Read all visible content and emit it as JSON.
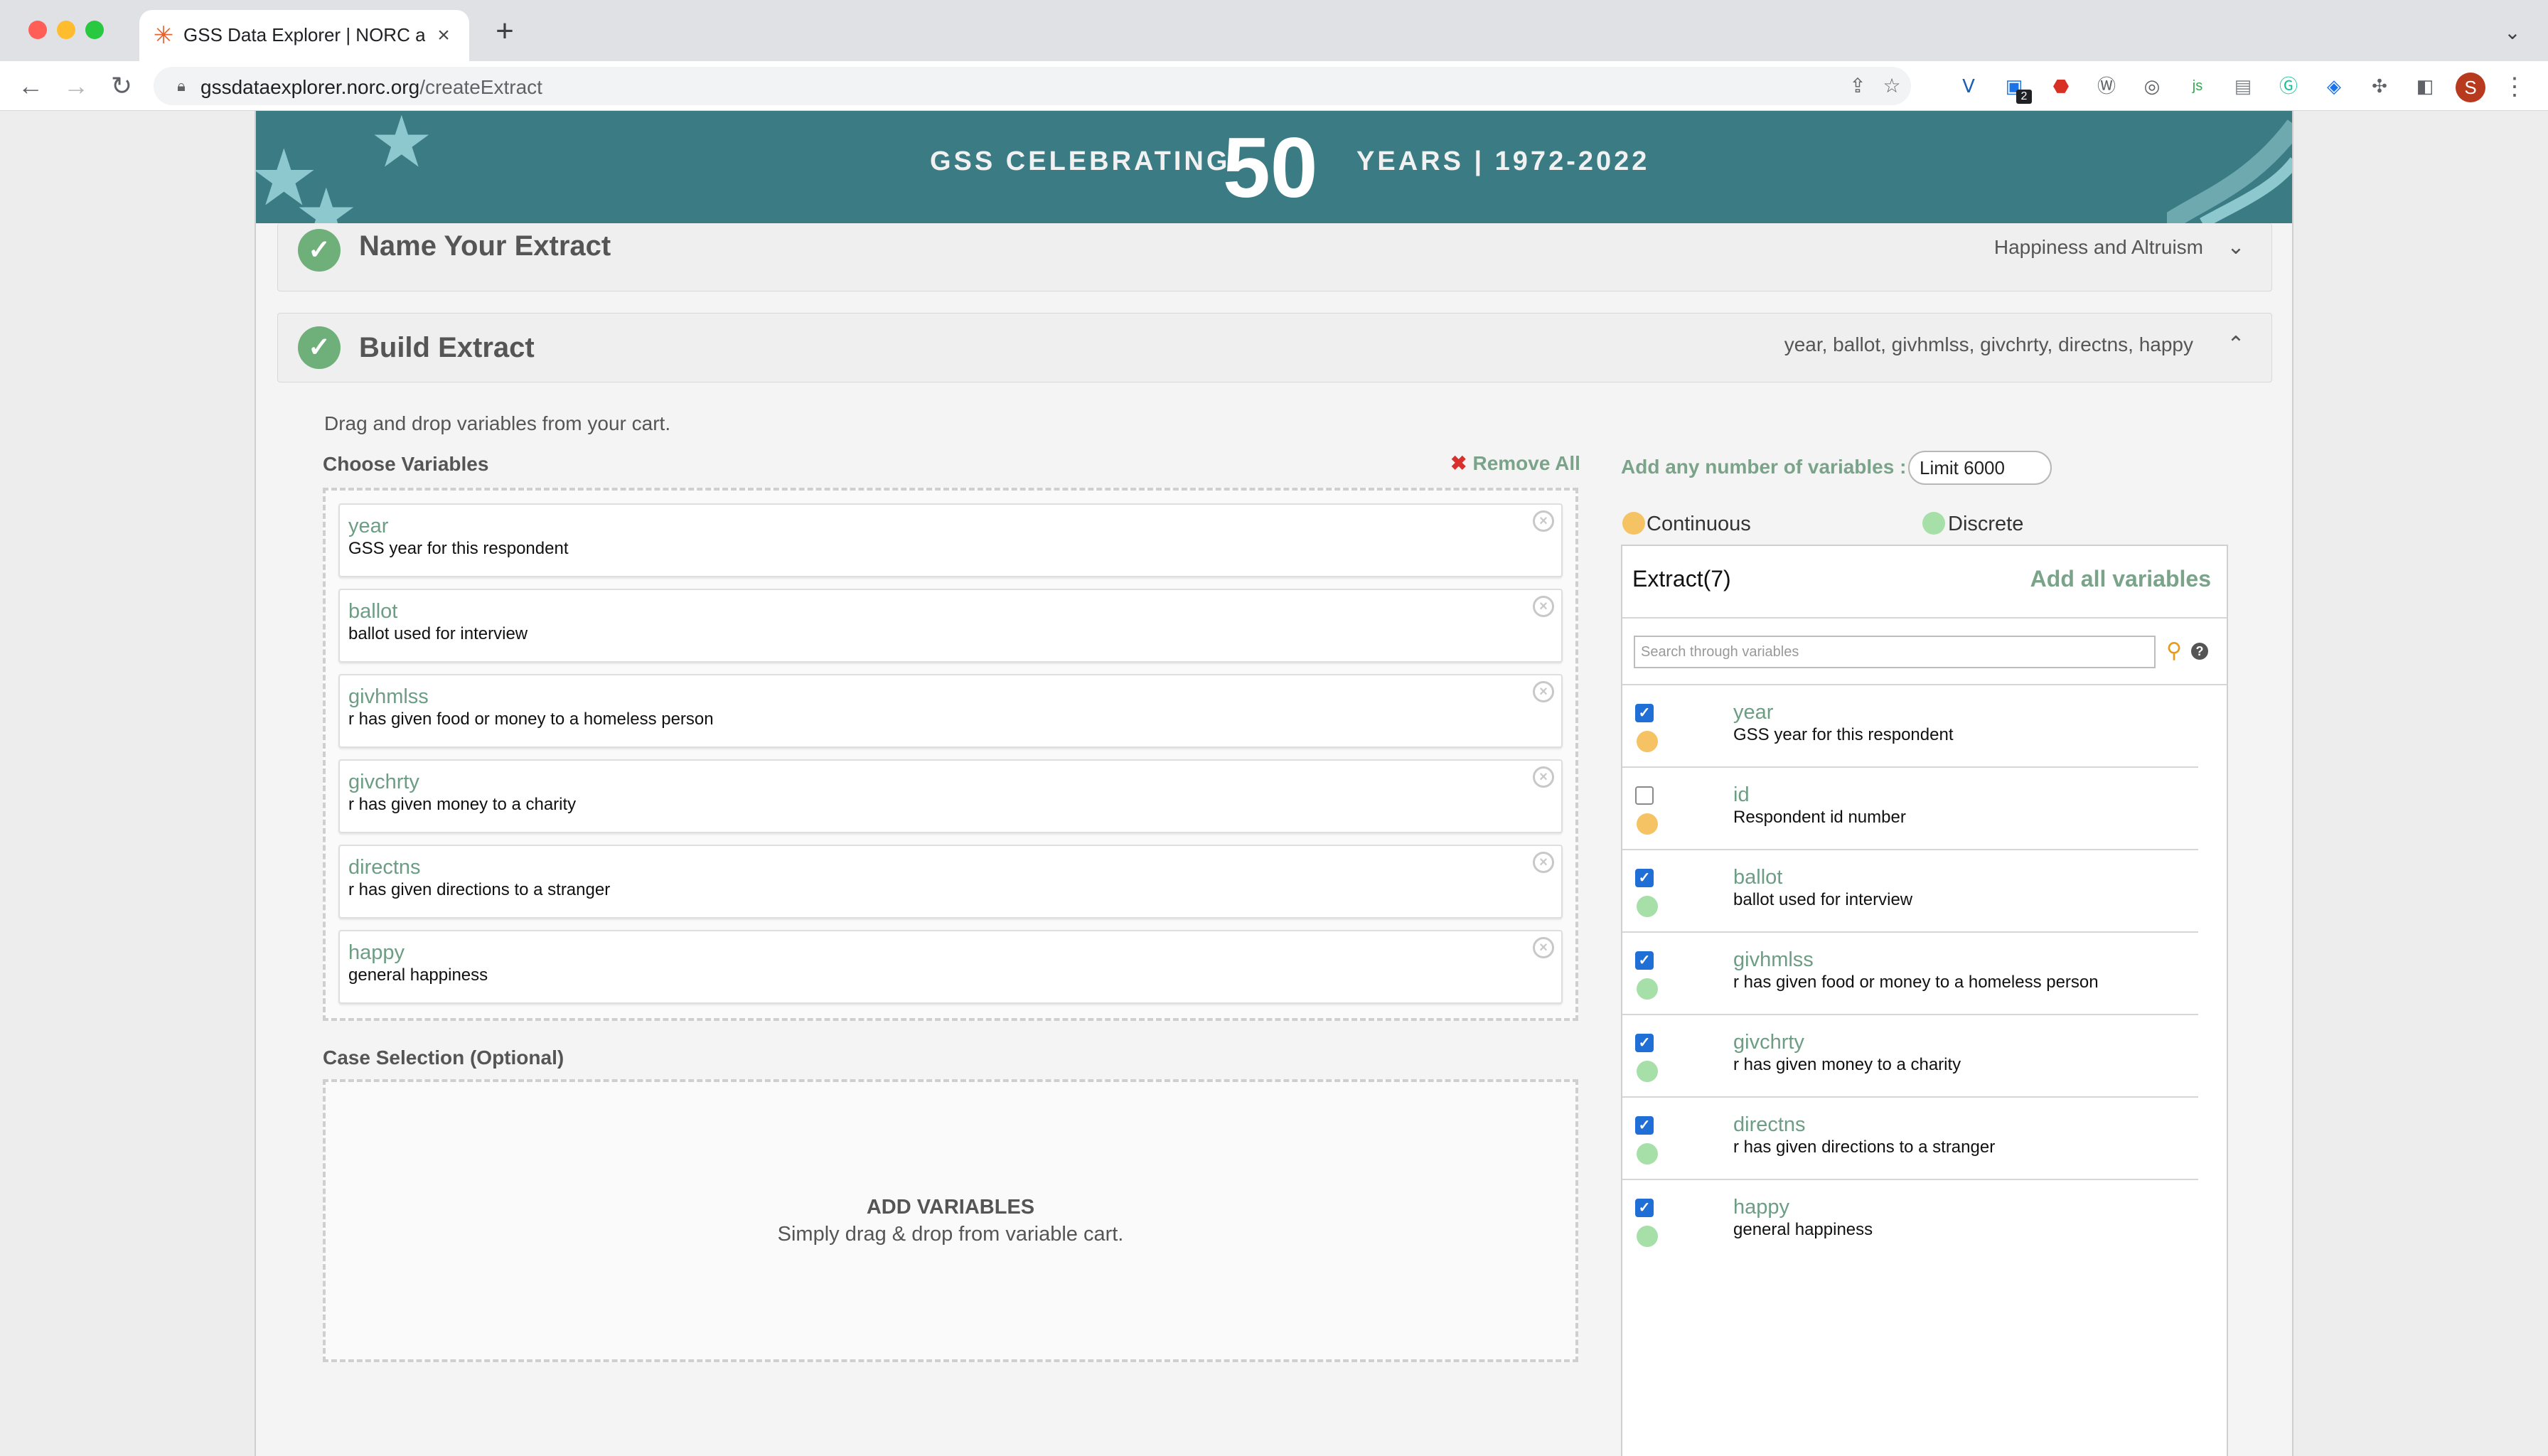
{
  "browser": {
    "tab_title": "GSS Data Explorer | NORC at th",
    "url_host": "gssdataexplorer.norc.org",
    "url_path": "/createExtract",
    "profile_initial": "S",
    "extension_badge": "2"
  },
  "banner": {
    "left_text": "GSS CELEBRATING",
    "fifty": "50",
    "right_text": "YEARS | 1972-2022"
  },
  "name_panel": {
    "title": "Name Your Extract",
    "summary": "Happiness and Altruism"
  },
  "build_panel": {
    "title": "Build Extract",
    "summary": "year, ballot, givhmlss, givchrty, directns, happy",
    "instruction": "Drag and drop variables from your cart.",
    "choose_label": "Choose Variables",
    "remove_all_label": "Remove All",
    "chosen": [
      {
        "name": "year",
        "desc": "GSS year for this respondent"
      },
      {
        "name": "ballot",
        "desc": "ballot used for interview"
      },
      {
        "name": "givhmlss",
        "desc": "r has given food or money to a homeless person"
      },
      {
        "name": "givchrty",
        "desc": "r has given money to a charity"
      },
      {
        "name": "directns",
        "desc": "r has given directions to a stranger"
      },
      {
        "name": "happy",
        "desc": "general happiness"
      }
    ],
    "case_label": "Case Selection (Optional)",
    "add_title": "ADD VARIABLES",
    "add_sub": "Simply drag & drop from variable cart."
  },
  "right": {
    "limit_label": "Add any number of variables :",
    "limit_value": "Limit 6000",
    "legend": {
      "continuous": "Continuous",
      "discrete": "Discrete"
    },
    "extract_title": "Extract(7)",
    "add_all_label": "Add all variables",
    "search_placeholder": "Search through variables",
    "items": [
      {
        "name": "year",
        "desc": "GSS year for this respondent",
        "checked": true,
        "kind": "continuous"
      },
      {
        "name": "id",
        "desc": "Respondent id number",
        "checked": false,
        "kind": "continuous"
      },
      {
        "name": "ballot",
        "desc": "ballot used for interview",
        "checked": true,
        "kind": "discrete"
      },
      {
        "name": "givhmlss",
        "desc": "r has given food or money to a homeless person",
        "checked": true,
        "kind": "discrete"
      },
      {
        "name": "givchrty",
        "desc": "r has given money to a charity",
        "checked": true,
        "kind": "discrete"
      },
      {
        "name": "directns",
        "desc": "r has given directions to a stranger",
        "checked": true,
        "kind": "discrete"
      },
      {
        "name": "happy",
        "desc": "general happiness",
        "checked": true,
        "kind": "discrete"
      }
    ]
  },
  "colors": {
    "continuous": "#f5c364",
    "discrete": "#a6e0a8",
    "accent": "#7aa38a",
    "banner": "#3a7b84"
  },
  "icons": {
    "tab_favicon": "norc-asterisk-icon",
    "check": "checkmark-icon",
    "remove": "close-circle-icon",
    "search": "magnifier-icon",
    "help": "question-icon"
  }
}
